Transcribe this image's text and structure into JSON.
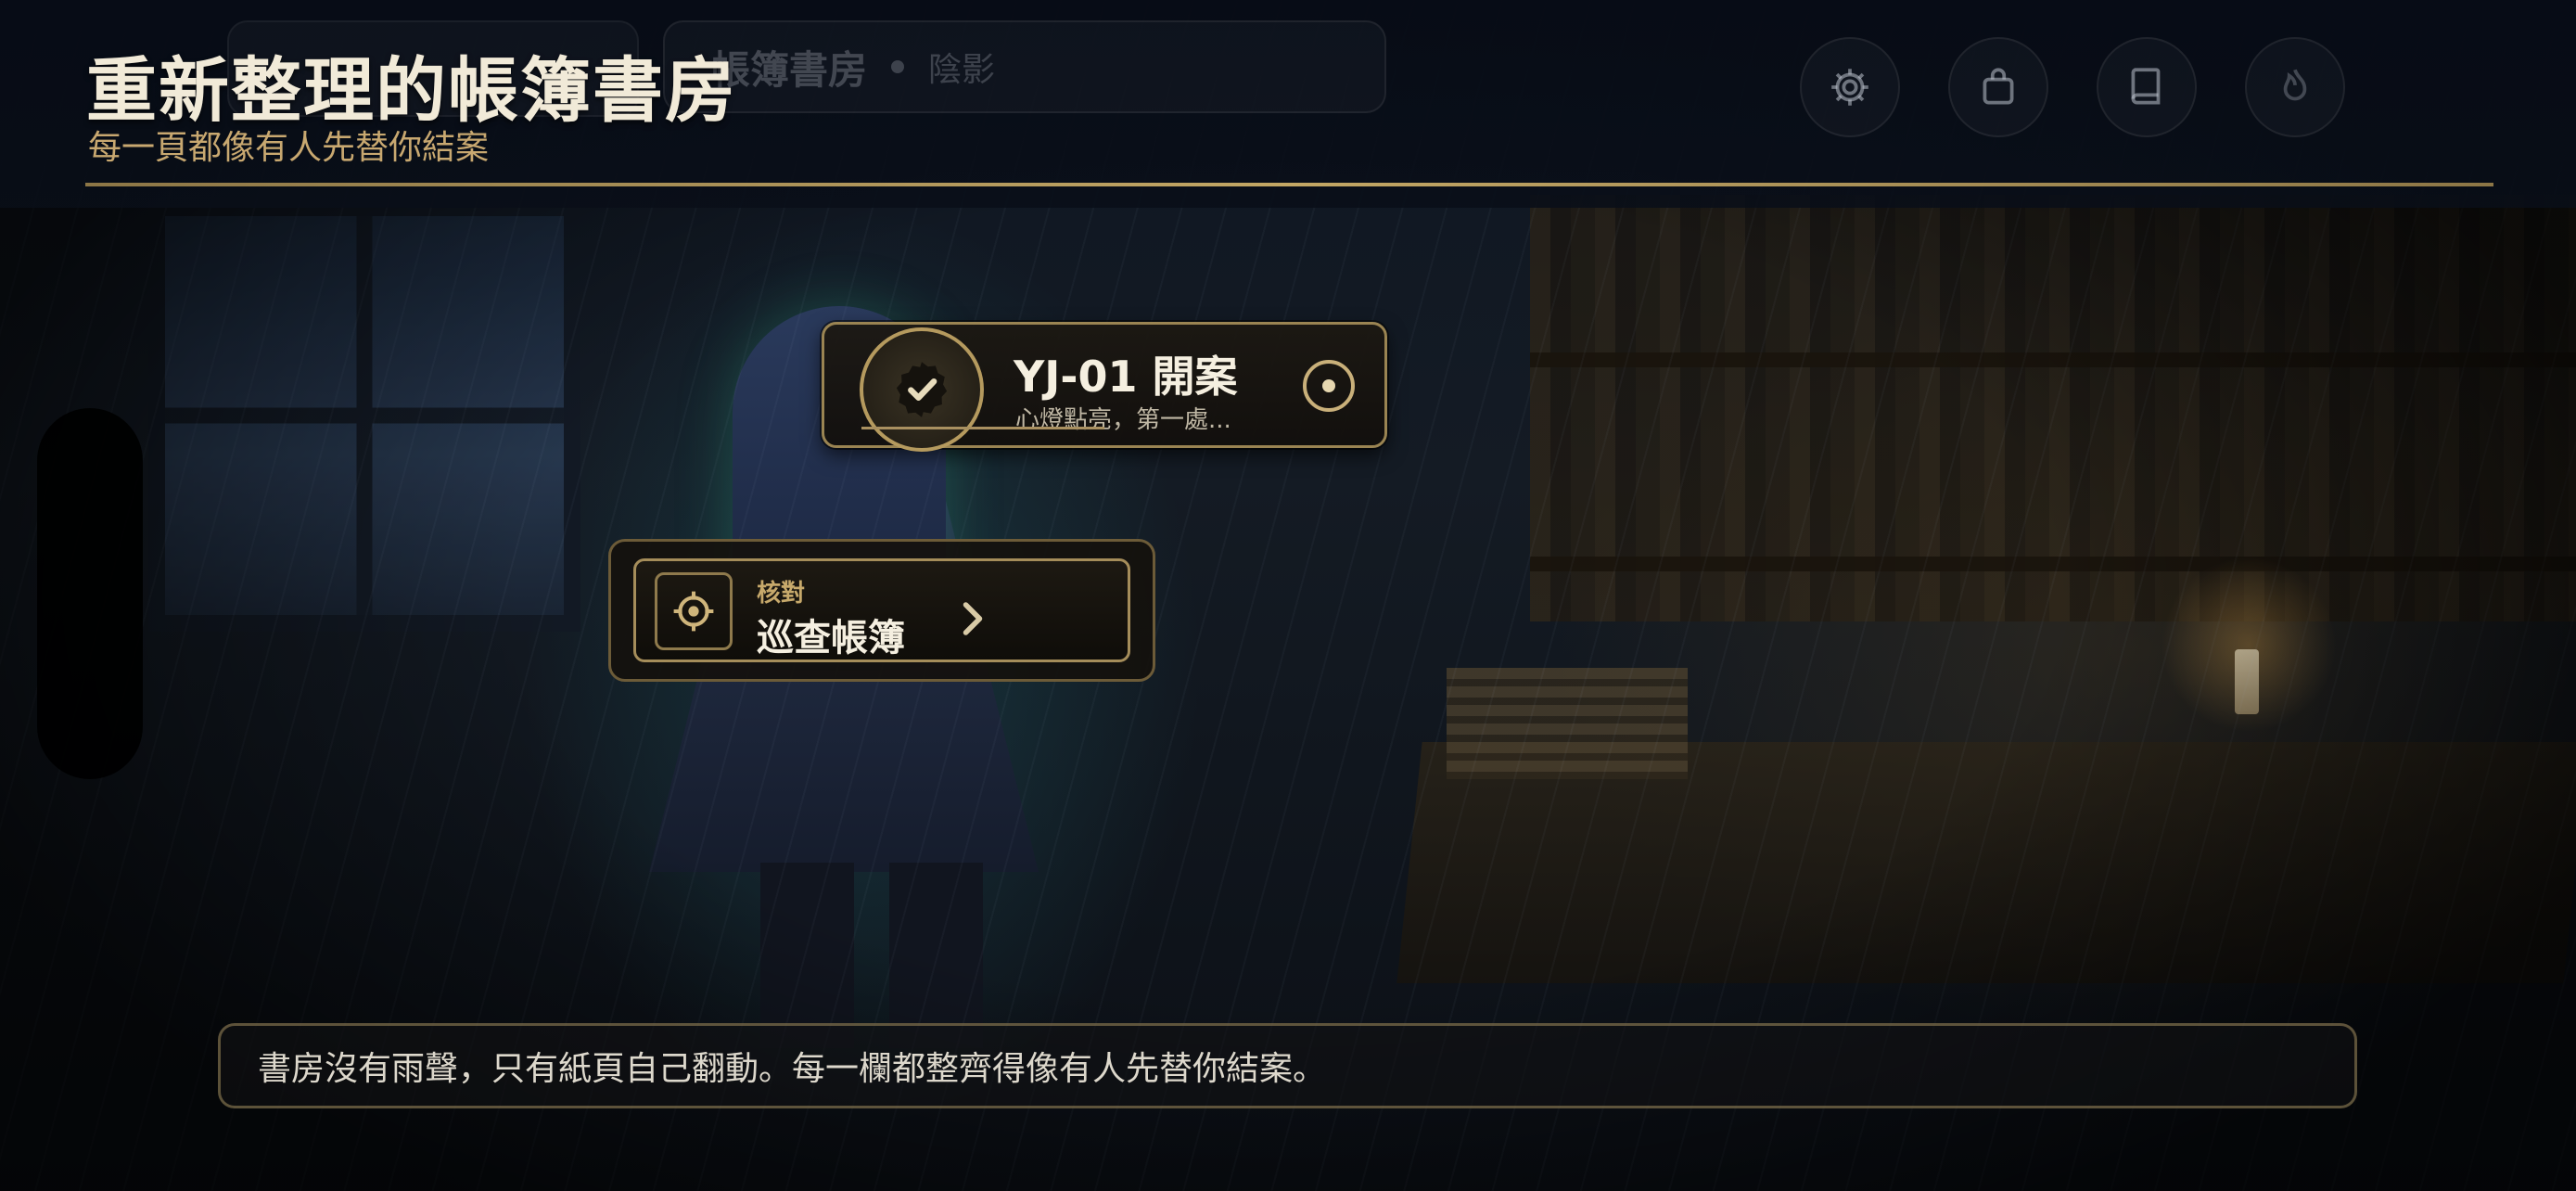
{
  "header": {
    "title": "重新整理的帳簿書房",
    "subtitle": "每一頁都像有人先替你結案"
  },
  "location": {
    "name": "帳簿書房",
    "weather": "陰影"
  },
  "toolbar": {
    "buttons": [
      {
        "name": "settings",
        "icon": "gear-icon"
      },
      {
        "name": "inventory",
        "icon": "bag-icon"
      },
      {
        "name": "journal",
        "icon": "book-icon"
      },
      {
        "name": "flame",
        "icon": "flame-icon"
      }
    ]
  },
  "objective": {
    "title": "YJ-01 開案",
    "description": "心燈點亮，第一處...",
    "icon": "check-badge-icon",
    "target_icon": "target-icon"
  },
  "action": {
    "kicker": "核對",
    "label": "巡查帳簿",
    "icon": "crosshair-icon"
  },
  "narration": {
    "text": "書房沒有雨聲，只有紙頁自己翻動。每一欄都整齊得像有人先替你結案。"
  },
  "colors": {
    "accent_gold": "#c3a765",
    "title_text": "#f1ead8",
    "subtitle_text": "#c8a870"
  }
}
